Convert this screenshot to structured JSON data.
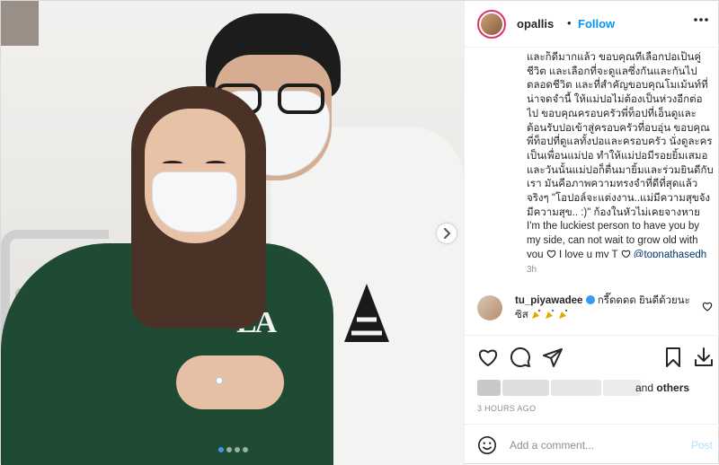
{
  "post": {
    "image_alt": "",
    "carousel": {
      "count": 4,
      "active": 1
    }
  },
  "header": {
    "username": "opallis",
    "separator": "•",
    "follow_label": "Follow"
  },
  "caption": {
    "text": "และก็ดีมากแล้ว ขอบคุณที่เลือกปอเป็นคู่ชีวิต และเลือกที่จะดูแลซึ่งกันและกันไปตลอดชีวิต และที่สำคัญขอบคุณโมเม้นท์ที่น่าจดจำนี้ ให้แม่ปอไม่ต้องเป็นห่วงอีกต่อไป ขอบคุณครอบครัวพี่ท็อปที่เอ็นดูและต้อนรับปอเข้าสู่ครอบครัวที่อบอุ่น ขอบคุณพี่ท็อปที่ดูแลทั้งปอและครอบครัว นั่งดูละครเป็นเพื่อนแม่ปอ ทำให้แม่ปอมีรอยยิ้มเสมอและวันนั้นแม่ปอก็ตื่นมายิ้มและร่วมยินดีกับเรา มันคือภาพความทรงจำที่ดีที่สุดแล้วจริงๆ \"โอปอล์จะแต่งงาน..แม่มีความสุขจัง มีความสุข.. :)\" ก้องในหัวไม่เคยจางหาย I'm the luckiest person to have you by my side, can not wait to grow old with you",
    "love": "I love u my T",
    "mention": "@topnathasedh",
    "time": "3h"
  },
  "comment": {
    "username": "tu_piyawadee",
    "text": "กรี๊ดดดด ยินดีด้วยนะ ซิส"
  },
  "likes": {
    "and_label": "and",
    "others_label": "others"
  },
  "posted_ago": "3 HOURS AGO",
  "add_comment": {
    "placeholder": "Add a comment...",
    "post_label": "Post"
  },
  "colors": {
    "accent": "#0095f6",
    "post_disabled": "#b2dffc",
    "border": "#efefef",
    "muted": "#8e8e8e"
  },
  "icons": [
    "more-icon",
    "next-icon",
    "heart-icon",
    "comment-icon",
    "share-icon",
    "bookmark-icon",
    "download-icon",
    "emoji-icon",
    "verified-icon",
    "party-icon"
  ]
}
